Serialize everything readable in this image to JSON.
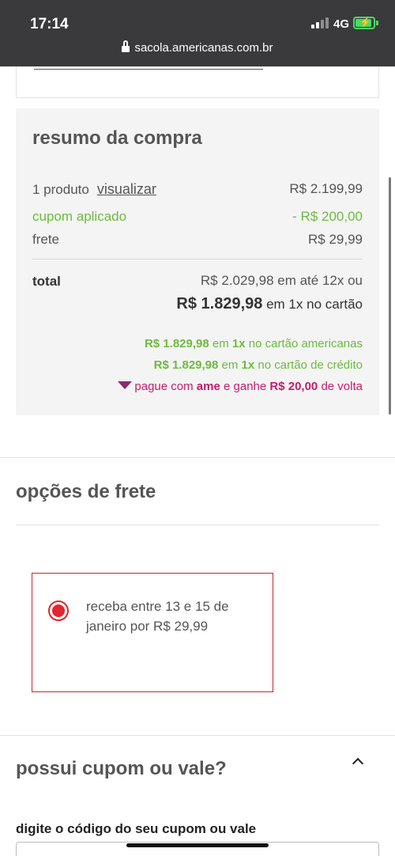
{
  "status": {
    "time": "17:14",
    "network": "4G"
  },
  "browser": {
    "url": "sacola.americanas.com.br"
  },
  "summary": {
    "title": "resumo da compra",
    "products_label": "1 produto",
    "view_link": "visualizar",
    "products_value": "R$ 2.199,99",
    "coupon_label": "cupom aplicado",
    "coupon_value": "- R$ 200,00",
    "shipping_label": "frete",
    "shipping_value": "R$ 29,99",
    "total_label": "total",
    "total_installments": "R$ 2.029,98 em até 12x ou",
    "total_cash_value": "R$ 1.829,98",
    "total_cash_suffix": " em 1x no cartão",
    "promo1": {
      "value": "R$ 1.829,98",
      "mid": " em ",
      "times": "1x",
      "suffix": " no cartão americanas"
    },
    "promo2": {
      "value": "R$ 1.829,98",
      "mid": " em ",
      "times": "1x",
      "suffix": " no cartão de crédito"
    },
    "promo3": {
      "prefix": "pague com ",
      "brand": "ame",
      "mid": " e ganhe ",
      "amount": "R$ 20,00",
      "suffix": " de volta"
    }
  },
  "shipping": {
    "title": "opções de frete",
    "option_text": "receba entre 13 e 15 de janeiro por R$ 29,99",
    "selected": true
  },
  "coupon": {
    "title": "possui cupom ou vale?",
    "field_label": "digite o código do seu cupom ou vale",
    "field_value": ""
  },
  "colors": {
    "accent_red": "#e2262d",
    "green": "#6dbb3e",
    "ame_pink": "#c41d6c"
  }
}
